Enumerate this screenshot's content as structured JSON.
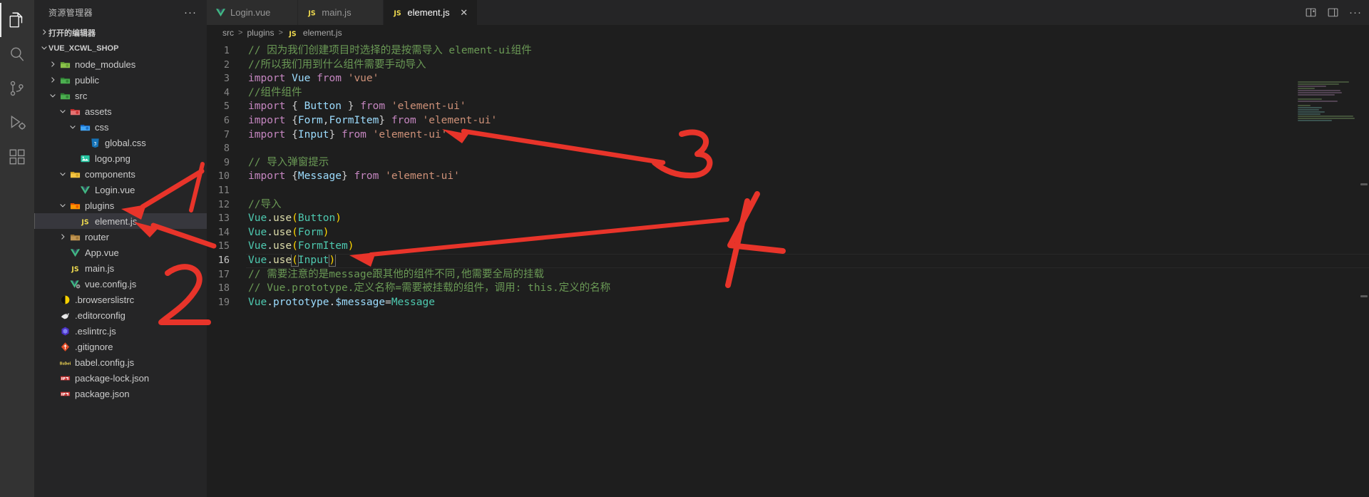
{
  "window": {
    "app": "Visual Studio Code",
    "theme_bg": "#1e1e1e",
    "sidebar_bg": "#252526",
    "activitybar_bg": "#333333",
    "accent": "#007acc",
    "annotation_color": "#e8342a"
  },
  "activity_bar": {
    "items": [
      {
        "name": "explorer-icon",
        "label": "资源管理器",
        "active": true
      },
      {
        "name": "search-icon",
        "label": "搜索",
        "active": false
      },
      {
        "name": "source-control-icon",
        "label": "源代码管理",
        "active": false
      },
      {
        "name": "run-debug-icon",
        "label": "运行和调试",
        "active": false
      },
      {
        "name": "extensions-icon",
        "label": "扩展",
        "active": false
      }
    ]
  },
  "sidebar": {
    "title": "资源管理器",
    "more_actions": "···",
    "open_editors_label": "打开的编辑器",
    "project_name": "VUE_XCWL_SHOP",
    "tree": [
      {
        "label": "node_modules",
        "indent": 1,
        "twisty": "collapsed",
        "icon": "npm-folder-icon",
        "selected": false
      },
      {
        "label": "public",
        "indent": 1,
        "twisty": "collapsed",
        "icon": "public-folder-icon",
        "selected": false
      },
      {
        "label": "src",
        "indent": 1,
        "twisty": "expanded",
        "icon": "src-folder-icon",
        "selected": false
      },
      {
        "label": "assets",
        "indent": 2,
        "twisty": "expanded",
        "icon": "assets-folder-icon",
        "selected": false
      },
      {
        "label": "css",
        "indent": 3,
        "twisty": "expanded",
        "icon": "css-folder-icon",
        "selected": false
      },
      {
        "label": "global.css",
        "indent": 4,
        "twisty": "none",
        "icon": "css-file-icon",
        "selected": false
      },
      {
        "label": "logo.png",
        "indent": 3,
        "twisty": "none",
        "icon": "image-file-icon",
        "selected": false
      },
      {
        "label": "components",
        "indent": 2,
        "twisty": "expanded",
        "icon": "components-folder-icon",
        "selected": false
      },
      {
        "label": "Login.vue",
        "indent": 3,
        "twisty": "none",
        "icon": "vue-file-icon",
        "selected": false
      },
      {
        "label": "plugins",
        "indent": 2,
        "twisty": "expanded",
        "icon": "plugins-folder-icon",
        "selected": false
      },
      {
        "label": "element.js",
        "indent": 3,
        "twisty": "none",
        "icon": "js-file-icon",
        "selected": true
      },
      {
        "label": "router",
        "indent": 2,
        "twisty": "collapsed",
        "icon": "folder-icon",
        "selected": false
      },
      {
        "label": "App.vue",
        "indent": 2,
        "twisty": "none",
        "icon": "vue-file-icon",
        "selected": false
      },
      {
        "label": "main.js",
        "indent": 2,
        "twisty": "none",
        "icon": "js-file-icon",
        "selected": false
      },
      {
        "label": "vue.config.js",
        "indent": 2,
        "twisty": "none",
        "icon": "vue-config-icon",
        "selected": false
      },
      {
        "label": ".browserslistrc",
        "indent": 1,
        "twisty": "none",
        "icon": "browserslist-icon",
        "selected": false
      },
      {
        "label": ".editorconfig",
        "indent": 1,
        "twisty": "none",
        "icon": "editorconfig-icon",
        "selected": false
      },
      {
        "label": ".eslintrc.js",
        "indent": 1,
        "twisty": "none",
        "icon": "eslint-icon",
        "selected": false
      },
      {
        "label": ".gitignore",
        "indent": 1,
        "twisty": "none",
        "icon": "git-icon",
        "selected": false
      },
      {
        "label": "babel.config.js",
        "indent": 1,
        "twisty": "none",
        "icon": "babel-icon",
        "selected": false
      },
      {
        "label": "package-lock.json",
        "indent": 1,
        "twisty": "none",
        "icon": "npm-icon",
        "selected": false
      },
      {
        "label": "package.json",
        "indent": 1,
        "twisty": "none",
        "icon": "npm-icon",
        "selected": false
      }
    ]
  },
  "tabs": [
    {
      "label": "Login.vue",
      "icon": "vue-file-icon",
      "active": false,
      "closable": false
    },
    {
      "label": "main.js",
      "icon": "js-file-icon",
      "active": false,
      "closable": false
    },
    {
      "label": "element.js",
      "icon": "js-file-icon",
      "active": true,
      "closable": true,
      "close": "✕"
    }
  ],
  "tab_actions": [
    {
      "name": "split-editor-right-icon"
    },
    {
      "name": "layout-panel-icon"
    },
    {
      "name": "more-actions-icon",
      "label": "···"
    }
  ],
  "breadcrumb": {
    "parts": [
      "src",
      "plugins",
      "element.js"
    ],
    "separator": ">",
    "file_icon_label": "JS"
  },
  "editor": {
    "current_line": 16,
    "total_lines": 19,
    "lines": [
      {
        "n": 1,
        "tokens": [
          {
            "t": "// 因为我们创建项目时选择的是按需导入 element-ui组件",
            "c": "t-com"
          }
        ]
      },
      {
        "n": 2,
        "tokens": [
          {
            "t": "//所以我们用到什么组件需要手动导入",
            "c": "t-com"
          }
        ]
      },
      {
        "n": 3,
        "tokens": [
          {
            "t": "import",
            "c": "t-kw"
          },
          {
            "t": " ",
            "c": "t-plain"
          },
          {
            "t": "Vue",
            "c": "t-var"
          },
          {
            "t": " ",
            "c": "t-plain"
          },
          {
            "t": "from",
            "c": "t-kw"
          },
          {
            "t": " ",
            "c": "t-plain"
          },
          {
            "t": "'vue'",
            "c": "t-str"
          }
        ]
      },
      {
        "n": 4,
        "tokens": [
          {
            "t": "//组件组件",
            "c": "t-com"
          }
        ]
      },
      {
        "n": 5,
        "tokens": [
          {
            "t": "import",
            "c": "t-kw"
          },
          {
            "t": " ",
            "c": "t-plain"
          },
          {
            "t": "{",
            "c": "t-punc"
          },
          {
            "t": " ",
            "c": "t-plain"
          },
          {
            "t": "Button",
            "c": "t-var"
          },
          {
            "t": " ",
            "c": "t-plain"
          },
          {
            "t": "}",
            "c": "t-punc"
          },
          {
            "t": " ",
            "c": "t-plain"
          },
          {
            "t": "from",
            "c": "t-kw"
          },
          {
            "t": " ",
            "c": "t-plain"
          },
          {
            "t": "'element-ui'",
            "c": "t-str"
          }
        ]
      },
      {
        "n": 6,
        "tokens": [
          {
            "t": "import",
            "c": "t-kw"
          },
          {
            "t": " ",
            "c": "t-plain"
          },
          {
            "t": "{",
            "c": "t-punc"
          },
          {
            "t": "Form",
            "c": "t-var"
          },
          {
            "t": ",",
            "c": "t-punc"
          },
          {
            "t": "FormItem",
            "c": "t-var"
          },
          {
            "t": "}",
            "c": "t-punc"
          },
          {
            "t": " ",
            "c": "t-plain"
          },
          {
            "t": "from",
            "c": "t-kw"
          },
          {
            "t": " ",
            "c": "t-plain"
          },
          {
            "t": "'element-ui'",
            "c": "t-str"
          }
        ]
      },
      {
        "n": 7,
        "tokens": [
          {
            "t": "import",
            "c": "t-kw"
          },
          {
            "t": " ",
            "c": "t-plain"
          },
          {
            "t": "{",
            "c": "t-punc"
          },
          {
            "t": "Input",
            "c": "t-var"
          },
          {
            "t": "}",
            "c": "t-punc"
          },
          {
            "t": " ",
            "c": "t-plain"
          },
          {
            "t": "from",
            "c": "t-kw"
          },
          {
            "t": " ",
            "c": "t-plain"
          },
          {
            "t": "'element-ui'",
            "c": "t-str"
          }
        ]
      },
      {
        "n": 8,
        "tokens": []
      },
      {
        "n": 9,
        "tokens": [
          {
            "t": "// 导入弹窗提示",
            "c": "t-com"
          }
        ]
      },
      {
        "n": 10,
        "tokens": [
          {
            "t": "import",
            "c": "t-kw"
          },
          {
            "t": " ",
            "c": "t-plain"
          },
          {
            "t": "{",
            "c": "t-punc"
          },
          {
            "t": "Message",
            "c": "t-var"
          },
          {
            "t": "}",
            "c": "t-punc"
          },
          {
            "t": " ",
            "c": "t-plain"
          },
          {
            "t": "from",
            "c": "t-kw"
          },
          {
            "t": " ",
            "c": "t-plain"
          },
          {
            "t": "'element-ui'",
            "c": "t-str"
          }
        ]
      },
      {
        "n": 11,
        "tokens": []
      },
      {
        "n": 12,
        "tokens": [
          {
            "t": "//导入",
            "c": "t-com"
          }
        ]
      },
      {
        "n": 13,
        "tokens": [
          {
            "t": "Vue",
            "c": "t-obj"
          },
          {
            "t": ".",
            "c": "t-plain"
          },
          {
            "t": "use",
            "c": "t-fn"
          },
          {
            "t": "(",
            "c": "t-br1"
          },
          {
            "t": "Button",
            "c": "t-obj"
          },
          {
            "t": ")",
            "c": "t-br1"
          }
        ]
      },
      {
        "n": 14,
        "tokens": [
          {
            "t": "Vue",
            "c": "t-obj"
          },
          {
            "t": ".",
            "c": "t-plain"
          },
          {
            "t": "use",
            "c": "t-fn"
          },
          {
            "t": "(",
            "c": "t-br1"
          },
          {
            "t": "Form",
            "c": "t-obj"
          },
          {
            "t": ")",
            "c": "t-br1"
          }
        ]
      },
      {
        "n": 15,
        "tokens": [
          {
            "t": "Vue",
            "c": "t-obj"
          },
          {
            "t": ".",
            "c": "t-plain"
          },
          {
            "t": "use",
            "c": "t-fn"
          },
          {
            "t": "(",
            "c": "t-br1"
          },
          {
            "t": "FormItem",
            "c": "t-obj"
          },
          {
            "t": ")",
            "c": "t-br1"
          }
        ]
      },
      {
        "n": 16,
        "tokens": [
          {
            "t": "Vue",
            "c": "t-obj"
          },
          {
            "t": ".",
            "c": "t-plain"
          },
          {
            "t": "use",
            "c": "t-fn"
          },
          {
            "t": "(",
            "c": "t-br1 selbox"
          },
          {
            "t": "Input",
            "c": "t-obj"
          },
          {
            "t": ")",
            "c": "t-br1 selbox"
          }
        ]
      },
      {
        "n": 17,
        "tokens": [
          {
            "t": "// 需要注意的是message跟其他的组件不同,他需要全局的挂载",
            "c": "t-com"
          }
        ]
      },
      {
        "n": 18,
        "tokens": [
          {
            "t": "// Vue.prototype.定义名称=需要被挂载的组件，调用: this.定义的名称",
            "c": "t-com"
          }
        ]
      },
      {
        "n": 19,
        "tokens": [
          {
            "t": "Vue",
            "c": "t-obj"
          },
          {
            "t": ".",
            "c": "t-plain"
          },
          {
            "t": "prototype",
            "c": "t-prop"
          },
          {
            "t": ".",
            "c": "t-plain"
          },
          {
            "t": "$message",
            "c": "t-prop"
          },
          {
            "t": "=",
            "c": "t-plain"
          },
          {
            "t": "Message",
            "c": "t-obj"
          }
        ]
      }
    ]
  },
  "annotations": [
    {
      "name": "arrow-to-plugins",
      "kind": "arrow"
    },
    {
      "name": "arrow-to-element-js",
      "kind": "arrow"
    },
    {
      "name": "arrow-to-import-input",
      "kind": "arrow"
    },
    {
      "name": "arrow-to-vue-use-input",
      "kind": "arrow"
    },
    {
      "name": "handwritten-digit-1",
      "kind": "digit",
      "value": "1"
    },
    {
      "name": "handwritten-digit-2",
      "kind": "digit",
      "value": "2"
    },
    {
      "name": "handwritten-digit-3",
      "kind": "digit",
      "value": "3"
    },
    {
      "name": "handwritten-digit-4",
      "kind": "digit",
      "value": "4"
    }
  ]
}
